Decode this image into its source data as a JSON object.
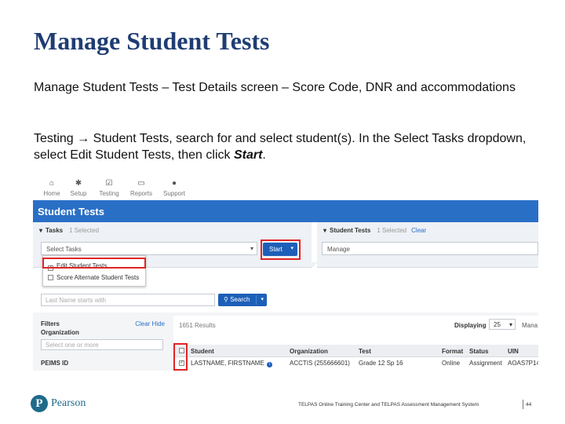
{
  "slide": {
    "title": "Manage Student Tests",
    "para1": "Manage Student Tests – Test Details screen – Score Code, DNR and accommodations",
    "para2_before": "Testing → Student Tests, search for and select student(s). In the Select Tasks dropdown, select Edit Student Tests, then click ",
    "para2_emph": "Start",
    "para2_after": "."
  },
  "nav": {
    "items": [
      {
        "label": "Home",
        "icon": "home-icon"
      },
      {
        "label": "Setup",
        "icon": "gear-icon"
      },
      {
        "label": "Testing",
        "icon": "checkbox-icon"
      },
      {
        "label": "Reports",
        "icon": "report-icon"
      },
      {
        "label": "Support",
        "icon": "support-icon"
      }
    ]
  },
  "app": {
    "banner_title": "Student Tests",
    "tasks_panel": {
      "header": "Tasks",
      "selected": "1 Selected",
      "select_placeholder": "Select Tasks",
      "start_label": "Start",
      "options": [
        "Edit Student Tests",
        "Score Alternate Student Tests"
      ]
    },
    "student_tests_panel": {
      "header": "Student Tests",
      "selected": "1 Selected",
      "clear_label": "Clear",
      "select_value": "Manage"
    },
    "search": {
      "placeholder": "Last Name starts with",
      "button_label": "Search"
    },
    "filters": {
      "title": "Filters",
      "links": "Clear  Hide",
      "organization_label": "Organization",
      "organization_placeholder": "Select one or more",
      "peims_label": "PEIMS ID"
    },
    "results": {
      "count": "1651 Results",
      "displaying_label": "Displaying",
      "displaying_value": "25",
      "manage_label": "Mana",
      "columns": [
        "Student",
        "Organization",
        "Test",
        "Format",
        "Status",
        "UIN"
      ],
      "rows": [
        {
          "student": "LASTNAME, FIRSTNAME",
          "organization": "ACCTIS (255666601)",
          "test": "Grade 12 Sp 16",
          "format": "Online",
          "status": "Assignment",
          "uin": "AOAS7P14"
        }
      ]
    }
  },
  "footer": {
    "logo_letter": "P",
    "logo_text": "Pearson",
    "text": "TELPAS Online Training Center and TELPAS Assessment Management System",
    "page": "44"
  },
  "colors": {
    "title": "#1f3d73",
    "banner": "#2a6fc6",
    "button": "#1d5fb8",
    "highlight": "#e02424",
    "pearson": "#1f6a8a"
  }
}
